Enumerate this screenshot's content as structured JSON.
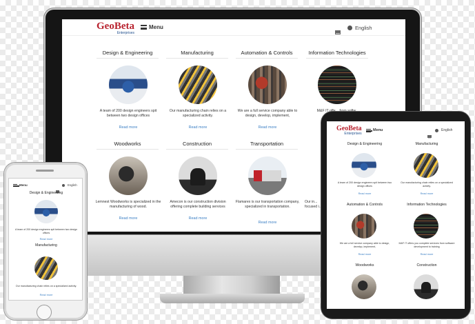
{
  "brand": {
    "name": "GeoBeta",
    "sub": "Enterprises",
    "color": "#b8232f"
  },
  "header": {
    "menu_label": "Menu",
    "language": "English",
    "mail_icon": "mail-icon",
    "globe_icon": "globe-icon"
  },
  "desktop": {
    "services": [
      {
        "title": "Design & Engineering",
        "desc": "A team of 200 design engineers spit between two design offices",
        "more": "Read more",
        "image": "cad-workstation"
      },
      {
        "title": "Manufacturing",
        "desc": "Our manufacturing chain relies on a specialized activity.",
        "more": "Read more",
        "image": "assembly-line"
      },
      {
        "title": "Automation & Controls",
        "desc": "We are a full service company able to design, develop, implement,",
        "more": "Read more",
        "image": "control-cabinet"
      },
      {
        "title": "Information Technologies",
        "desc": "M&F IT offe... from softw...",
        "more": "",
        "image": "code-screen"
      },
      {
        "title": "Woodworks",
        "desc": "Lemnest Woodworks is specialized in the manufacturing of wood.",
        "more": "Read more",
        "image": "woodworker"
      },
      {
        "title": "Construction",
        "desc": "Amecon is our construction division offering complete building services",
        "more": "Read more",
        "image": "workers-silhouette"
      },
      {
        "title": "Transportation",
        "desc": "Flamarex is our transportation company, specialized in transportation.",
        "more": "Read more",
        "image": "truck"
      },
      {
        "title": "",
        "desc": "Our in... focused i...",
        "more": "",
        "image": ""
      }
    ]
  },
  "tablet": {
    "services": [
      {
        "title": "Design & Engineering",
        "desc": "A team of 200 design engineers spit between two design offices",
        "more": "Read more"
      },
      {
        "title": "Manufacturing",
        "desc": "Our manufacturing chain relies on a specialized activity.",
        "more": "Read more"
      },
      {
        "title": "Automation & Controls",
        "desc": "We are a full service company able to design, develop, implement,",
        "more": "Read more"
      },
      {
        "title": "Information Technologies",
        "desc": "M&F IT offers you complete services from software development to training",
        "more": "Read more"
      },
      {
        "title": "Woodworks",
        "desc": "",
        "more": ""
      },
      {
        "title": "Construction",
        "desc": "",
        "more": ""
      }
    ]
  },
  "phone": {
    "services": [
      {
        "title": "Design & Engineering",
        "desc": "A team of 200 design engineers spit between two design offices",
        "more": "Read more"
      },
      {
        "title": "Manufacturing",
        "desc": "Our manufacturing chain relies on a specialized activity.",
        "more": "Read more"
      }
    ]
  }
}
